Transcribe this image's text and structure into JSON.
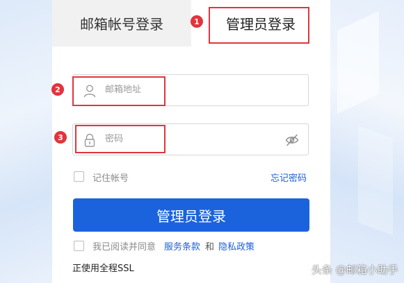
{
  "tabs": {
    "email_login": "邮箱帐号登录",
    "admin_login": "管理员登录"
  },
  "form": {
    "email_placeholder": "邮箱地址",
    "password_placeholder": "密码",
    "remember_label": "记住帐号",
    "forgot_password": "忘记密码",
    "submit_label": "管理员登录",
    "agree_prefix": "我已阅读并同意",
    "terms_link": "服务条款",
    "and_word": "和",
    "privacy_link": "隐私政策",
    "ssl_notice": "正使用全程SSL"
  },
  "annotations": [
    "1",
    "2",
    "3"
  ],
  "watermark": "头条 @邮箱小助手",
  "colors": {
    "accent": "#1a63dc",
    "annotation": "#e0353b",
    "link": "#1d5fd6"
  },
  "icons": [
    "user-icon",
    "lock-icon",
    "eye-hidden-icon"
  ]
}
